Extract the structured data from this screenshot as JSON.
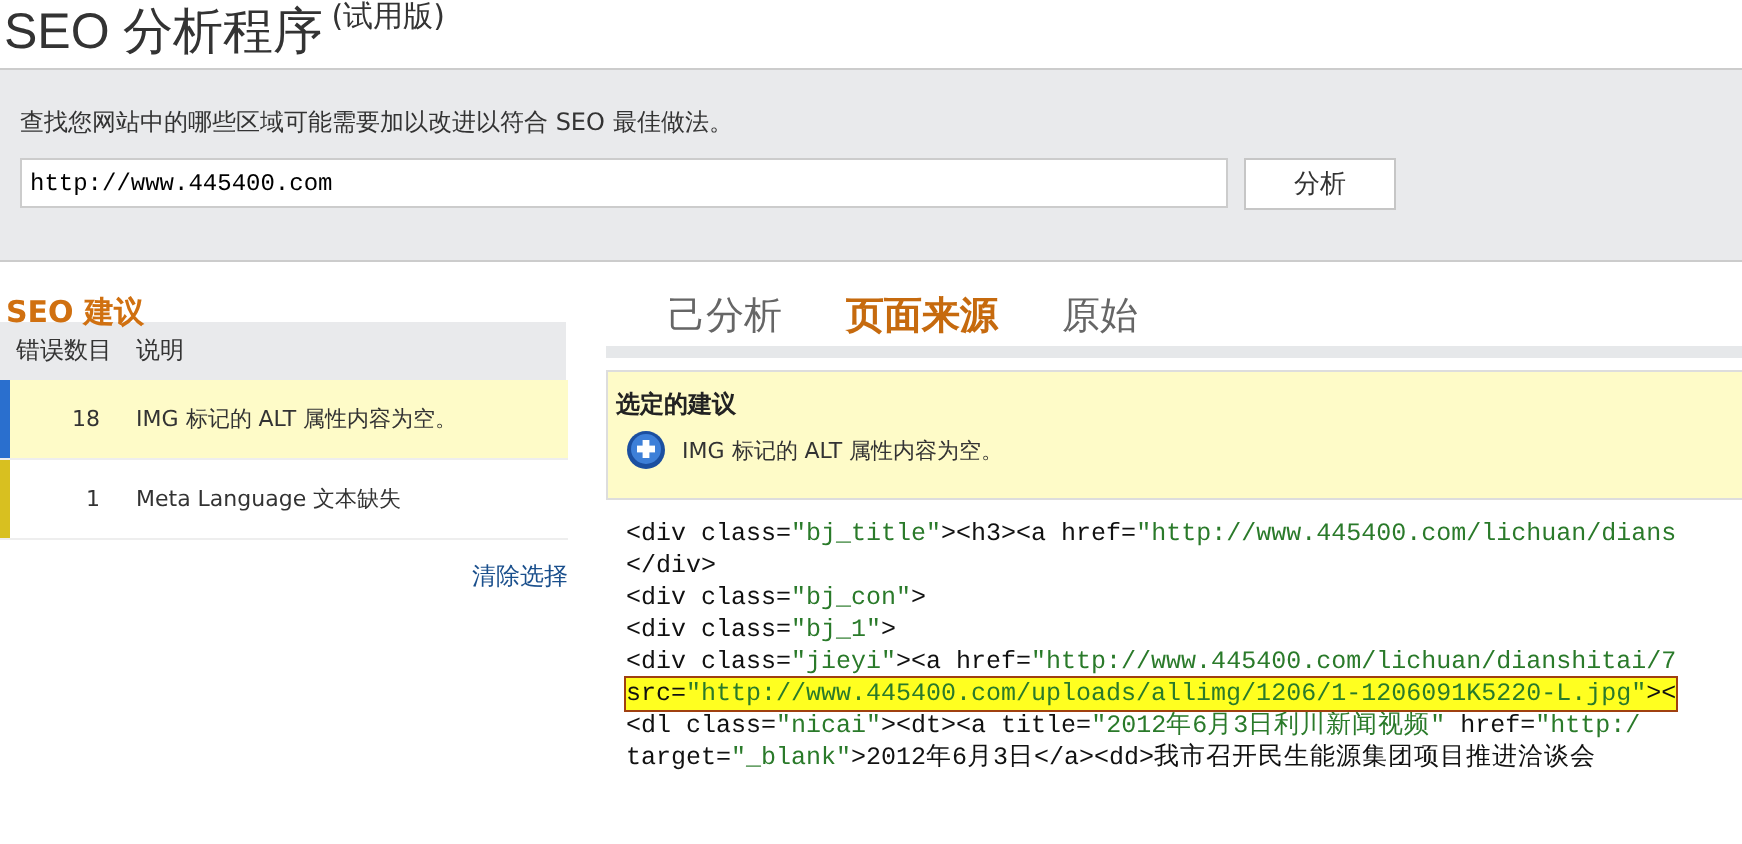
{
  "header": {
    "title": "SEO 分析程序",
    "edition": "(试用版)"
  },
  "analyze_panel": {
    "description": "查找您网站中的哪些区域可能需要加以改进以符合 SEO 最佳做法。",
    "url_value": "http://www.445400.com",
    "button": "分析"
  },
  "suggestions": {
    "title": "SEO 建议",
    "columns": [
      "错误数目",
      "说明"
    ],
    "rows": [
      {
        "count": "18",
        "description": "IMG 标记的 ALT 属性内容为空。",
        "selected": true,
        "color": "#2a6fce"
      },
      {
        "count": "1",
        "description": "Meta Language 文本缺失",
        "selected": false,
        "color": "#d8c020"
      }
    ],
    "clear_link": "清除选择"
  },
  "tabs": [
    {
      "label": "己分析",
      "selected": false
    },
    {
      "label": "页面来源",
      "selected": true
    },
    {
      "label": "原始",
      "selected": false
    }
  ],
  "selected_suggestion": {
    "title": "选定的建议",
    "text": "IMG 标记的 ALT 属性内容为空。"
  },
  "source_lines": [
    {
      "highlighted": false,
      "tokens": [
        {
          "kind": "tag",
          "text": "<div class="
        },
        {
          "kind": "value",
          "text": "\"bj_title\""
        },
        {
          "kind": "tag",
          "text": "><h3><a href="
        },
        {
          "kind": "value",
          "text": "\"http://www.445400.com/lichuan/dians"
        }
      ]
    },
    {
      "highlighted": false,
      "tokens": [
        {
          "kind": "tag",
          "text": "</div>"
        }
      ]
    },
    {
      "highlighted": false,
      "tokens": [
        {
          "kind": "tag",
          "text": "<div class="
        },
        {
          "kind": "value",
          "text": "\"bj_con\""
        },
        {
          "kind": "tag",
          "text": ">"
        }
      ]
    },
    {
      "highlighted": false,
      "tokens": [
        {
          "kind": "tag",
          "text": "<div class="
        },
        {
          "kind": "value",
          "text": "\"bj_1\""
        },
        {
          "kind": "tag",
          "text": ">"
        }
      ]
    },
    {
      "highlighted": false,
      "tokens": [
        {
          "kind": "tag",
          "text": "<div class="
        },
        {
          "kind": "value",
          "text": "\"jieyi\""
        },
        {
          "kind": "tag",
          "text": "><a href="
        },
        {
          "kind": "value",
          "text": "\"http://www.445400.com/lichuan/dianshitai/7"
        }
      ]
    },
    {
      "highlighted": true,
      "tokens": [
        {
          "kind": "tag",
          "text": "src="
        },
        {
          "kind": "value",
          "text": "\"http://www.445400.com/uploads/allimg/1206/1-1206091K5220-L.jpg\""
        },
        {
          "kind": "tag",
          "text": "><"
        }
      ]
    },
    {
      "highlighted": false,
      "tokens": [
        {
          "kind": "tag",
          "text": "<dl class="
        },
        {
          "kind": "value",
          "text": "\"nicai\""
        },
        {
          "kind": "tag",
          "text": "><dt><a title="
        },
        {
          "kind": "value",
          "text": "\"2012年6月3日利川新闻视频\""
        },
        {
          "kind": "tag",
          "text": " href="
        },
        {
          "kind": "value",
          "text": "\"http:/"
        }
      ]
    },
    {
      "highlighted": false,
      "tokens": [
        {
          "kind": "tag",
          "text": "target="
        },
        {
          "kind": "value",
          "text": "\"_blank\""
        },
        {
          "kind": "tag",
          "text": ">2012年6月3日</a><dd>我市召开民生能源集团项目推进洽谈会"
        }
      ]
    }
  ]
}
